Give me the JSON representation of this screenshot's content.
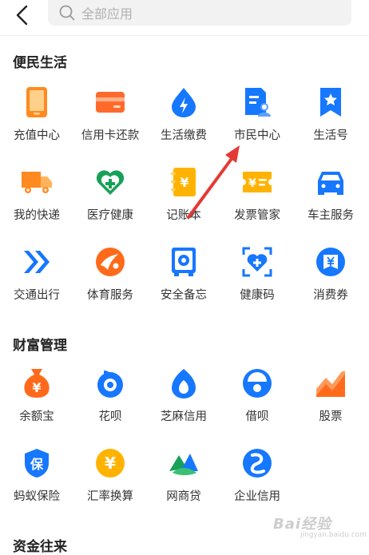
{
  "header": {
    "search_placeholder": "全部应用"
  },
  "sections": [
    {
      "title": "便民生活",
      "items": [
        {
          "label": "充值中心",
          "icon": "phone-icon"
        },
        {
          "label": "信用卡还款",
          "icon": "credit-card-icon"
        },
        {
          "label": "生活缴费",
          "icon": "utility-bolt-icon"
        },
        {
          "label": "市民中心",
          "icon": "citizen-card-icon"
        },
        {
          "label": "生活号",
          "icon": "bookmark-star-icon"
        },
        {
          "label": "我的快递",
          "icon": "truck-icon"
        },
        {
          "label": "医疗健康",
          "icon": "medical-heart-icon"
        },
        {
          "label": "记账本",
          "icon": "ledger-book-icon"
        },
        {
          "label": "发票管家",
          "icon": "invoice-icon"
        },
        {
          "label": "车主服务",
          "icon": "car-icon"
        },
        {
          "label": "交通出行",
          "icon": "transit-arrow-icon"
        },
        {
          "label": "体育服务",
          "icon": "sports-icon"
        },
        {
          "label": "安全备忘",
          "icon": "safe-icon"
        },
        {
          "label": "健康码",
          "icon": "health-code-icon"
        },
        {
          "label": "消费券",
          "icon": "coupon-icon"
        }
      ]
    },
    {
      "title": "财富管理",
      "items": [
        {
          "label": "余额宝",
          "icon": "money-bag-icon"
        },
        {
          "label": "花呗",
          "icon": "huabei-icon"
        },
        {
          "label": "芝麻信用",
          "icon": "sesame-credit-icon"
        },
        {
          "label": "借呗",
          "icon": "jiebei-icon"
        },
        {
          "label": "股票",
          "icon": "stock-chart-icon"
        },
        {
          "label": "蚂蚁保险",
          "icon": "insurance-shield-icon"
        },
        {
          "label": "汇率换算",
          "icon": "exchange-rate-icon"
        },
        {
          "label": "网商贷",
          "icon": "mybank-loan-icon"
        },
        {
          "label": "企业信用",
          "icon": "enterprise-credit-icon"
        }
      ]
    },
    {
      "title": "资金往来",
      "items": []
    }
  ],
  "icon_glyphs": {
    "ledger": "¥",
    "invoice": "¥",
    "money_bag": "¥",
    "exchange": "¥",
    "insurance": "保"
  },
  "watermark": {
    "text": "Bai经验",
    "sub": "jingyan.baidu.com"
  },
  "colors": {
    "blue": "#1677ff",
    "orange": "#ff7d1a",
    "yellow": "#ffb300",
    "green": "#18a058",
    "red_arrow": "#e53935"
  }
}
